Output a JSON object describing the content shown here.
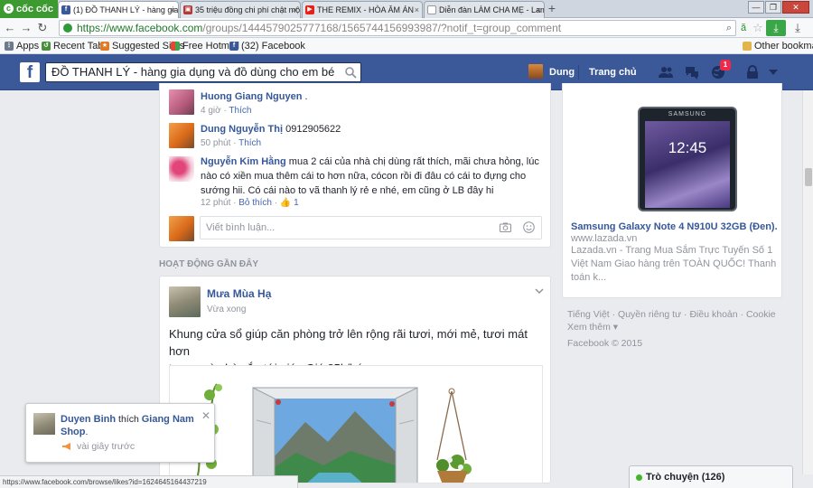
{
  "browser": {
    "brand": "cốc cốc",
    "tabs": [
      {
        "label": "(1) ĐỒ THANH LÝ - hàng gia d",
        "active": true
      },
      {
        "label": "35 triệu đồng chi phí chật một",
        "active": false
      },
      {
        "label": "THE REMIX - HÒA ÂM ÁN",
        "active": false
      },
      {
        "label": "Diễn đàn LÀM CHA MẸ - Lam",
        "active": false
      }
    ],
    "url": {
      "host": "https://www.facebook.com",
      "path": "/groups/1444579025777168/1565744156993987/?notif_t=group_comment"
    },
    "bookmarks": [
      "Apps",
      "Recent Tabs",
      "Suggested Sites",
      "Free Hotmail",
      "(32) Facebook"
    ],
    "other_bookmarks": "Other bookmarks",
    "status_url": "https://www.facebook.com/browse/likes?id=1624645164437219"
  },
  "facebook": {
    "search_value": "ĐỒ THANH LÝ - hàng gia dụng và đồ dùng cho em bé",
    "user": "Dung",
    "home": "Trang chủ",
    "notif_count": "1",
    "colors": {
      "brand": "#3b5998",
      "link": "#365899",
      "badge": "#f02849"
    }
  },
  "comments": [
    {
      "name": "Huong Giang Nguyen",
      "text": ".",
      "time": "4 giờ",
      "action": "Thích"
    },
    {
      "name": "Dung Nguyễn Thị",
      "text": "0912905622",
      "time": "50 phút",
      "action": "Thích"
    },
    {
      "name": "Nguyễn Kim Hằng",
      "text_line1": "mua 2 cái của nhà chị dùng rất thích, mãi chưa hỏng, lúc",
      "text_line2": "nào có xiền mua thêm cái to hơn nữa, cócon rồi đi đâu có cái to đựng cho",
      "text_line3": "sướng hii. Có cái nào to vã thanh lý rẻ e nhé, em cũng ở LB đây hi",
      "time": "12 phút",
      "action": "Bỏ thích",
      "likes": "1"
    }
  ],
  "comment_placeholder": "Viết bình luận...",
  "section_title": "HOẠT ĐỘNG GẦN ĐÂY",
  "post": {
    "author": "Mưa Mùa Hạ",
    "time": "Vừa xong",
    "text_line1": "Khung cửa sổ giúp căn phòng trở lên rộng rãi tươi, mới mẻ, tươi mát hơn",
    "text_line2": "trong mùa hè sắp tới giá . Giá 85k/bức."
  },
  "ad": {
    "title": "Samsung Galaxy Note 4 N910U 32GB (Đen)...",
    "domain": "www.lazada.vn",
    "desc_line1": "Lazada.vn - Trang Mua Sắm Trực Tuyến Số 1",
    "desc_line2": "Việt Nam Giao hàng trên TOÀN QUỐC! Thanh",
    "desc_line3": "toán k...",
    "phone_brand": "SAMSUNG",
    "phone_time": "12:45"
  },
  "footer": {
    "l1": "Tiếng Việt",
    "l2": "Quyền riêng tư",
    "l3": "Điều khoản",
    "l4": "Cookie",
    "l5": "Xem thêm",
    "copyright": "Facebook © 2015"
  },
  "notification": {
    "user": "Duyen Binh",
    "verb": "thích",
    "target": "Giang Nam",
    "target2": "Shop",
    "time": "vài giây trước"
  },
  "chat": {
    "label": "Trò chuyện (126)"
  }
}
